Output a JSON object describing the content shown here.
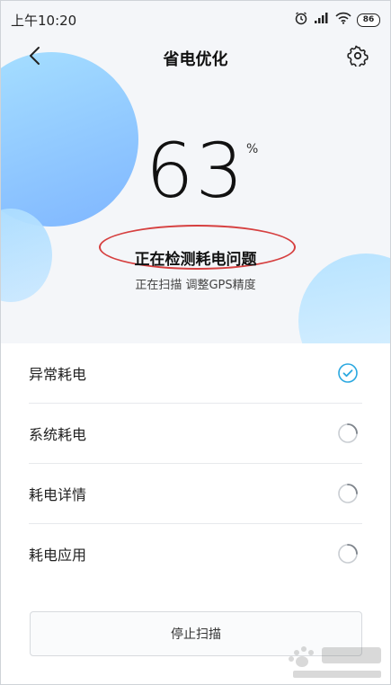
{
  "statusbar": {
    "time": "上午10:20",
    "battery": "86",
    "icons": [
      "alarm-icon",
      "signal-icon",
      "wifi-icon",
      "battery-icon"
    ]
  },
  "header": {
    "title": "省电优化",
    "back_icon": "chevron-left-icon",
    "settings_icon": "gear-icon"
  },
  "scan": {
    "percent": "63",
    "percent_unit": "%",
    "progress_value": 63,
    "status": "正在检测耗电问题",
    "substatus": "正在扫描 调整GPS精度"
  },
  "list": {
    "items": [
      {
        "label": "异常耗电",
        "state": "done"
      },
      {
        "label": "系统耗电",
        "state": "pending"
      },
      {
        "label": "耗电详情",
        "state": "pending"
      },
      {
        "label": "耗电应用",
        "state": "pending"
      }
    ]
  },
  "actions": {
    "stop_label": "停止扫描"
  },
  "colors": {
    "accent": "#2aa8e0",
    "annotation": "#d64040"
  }
}
